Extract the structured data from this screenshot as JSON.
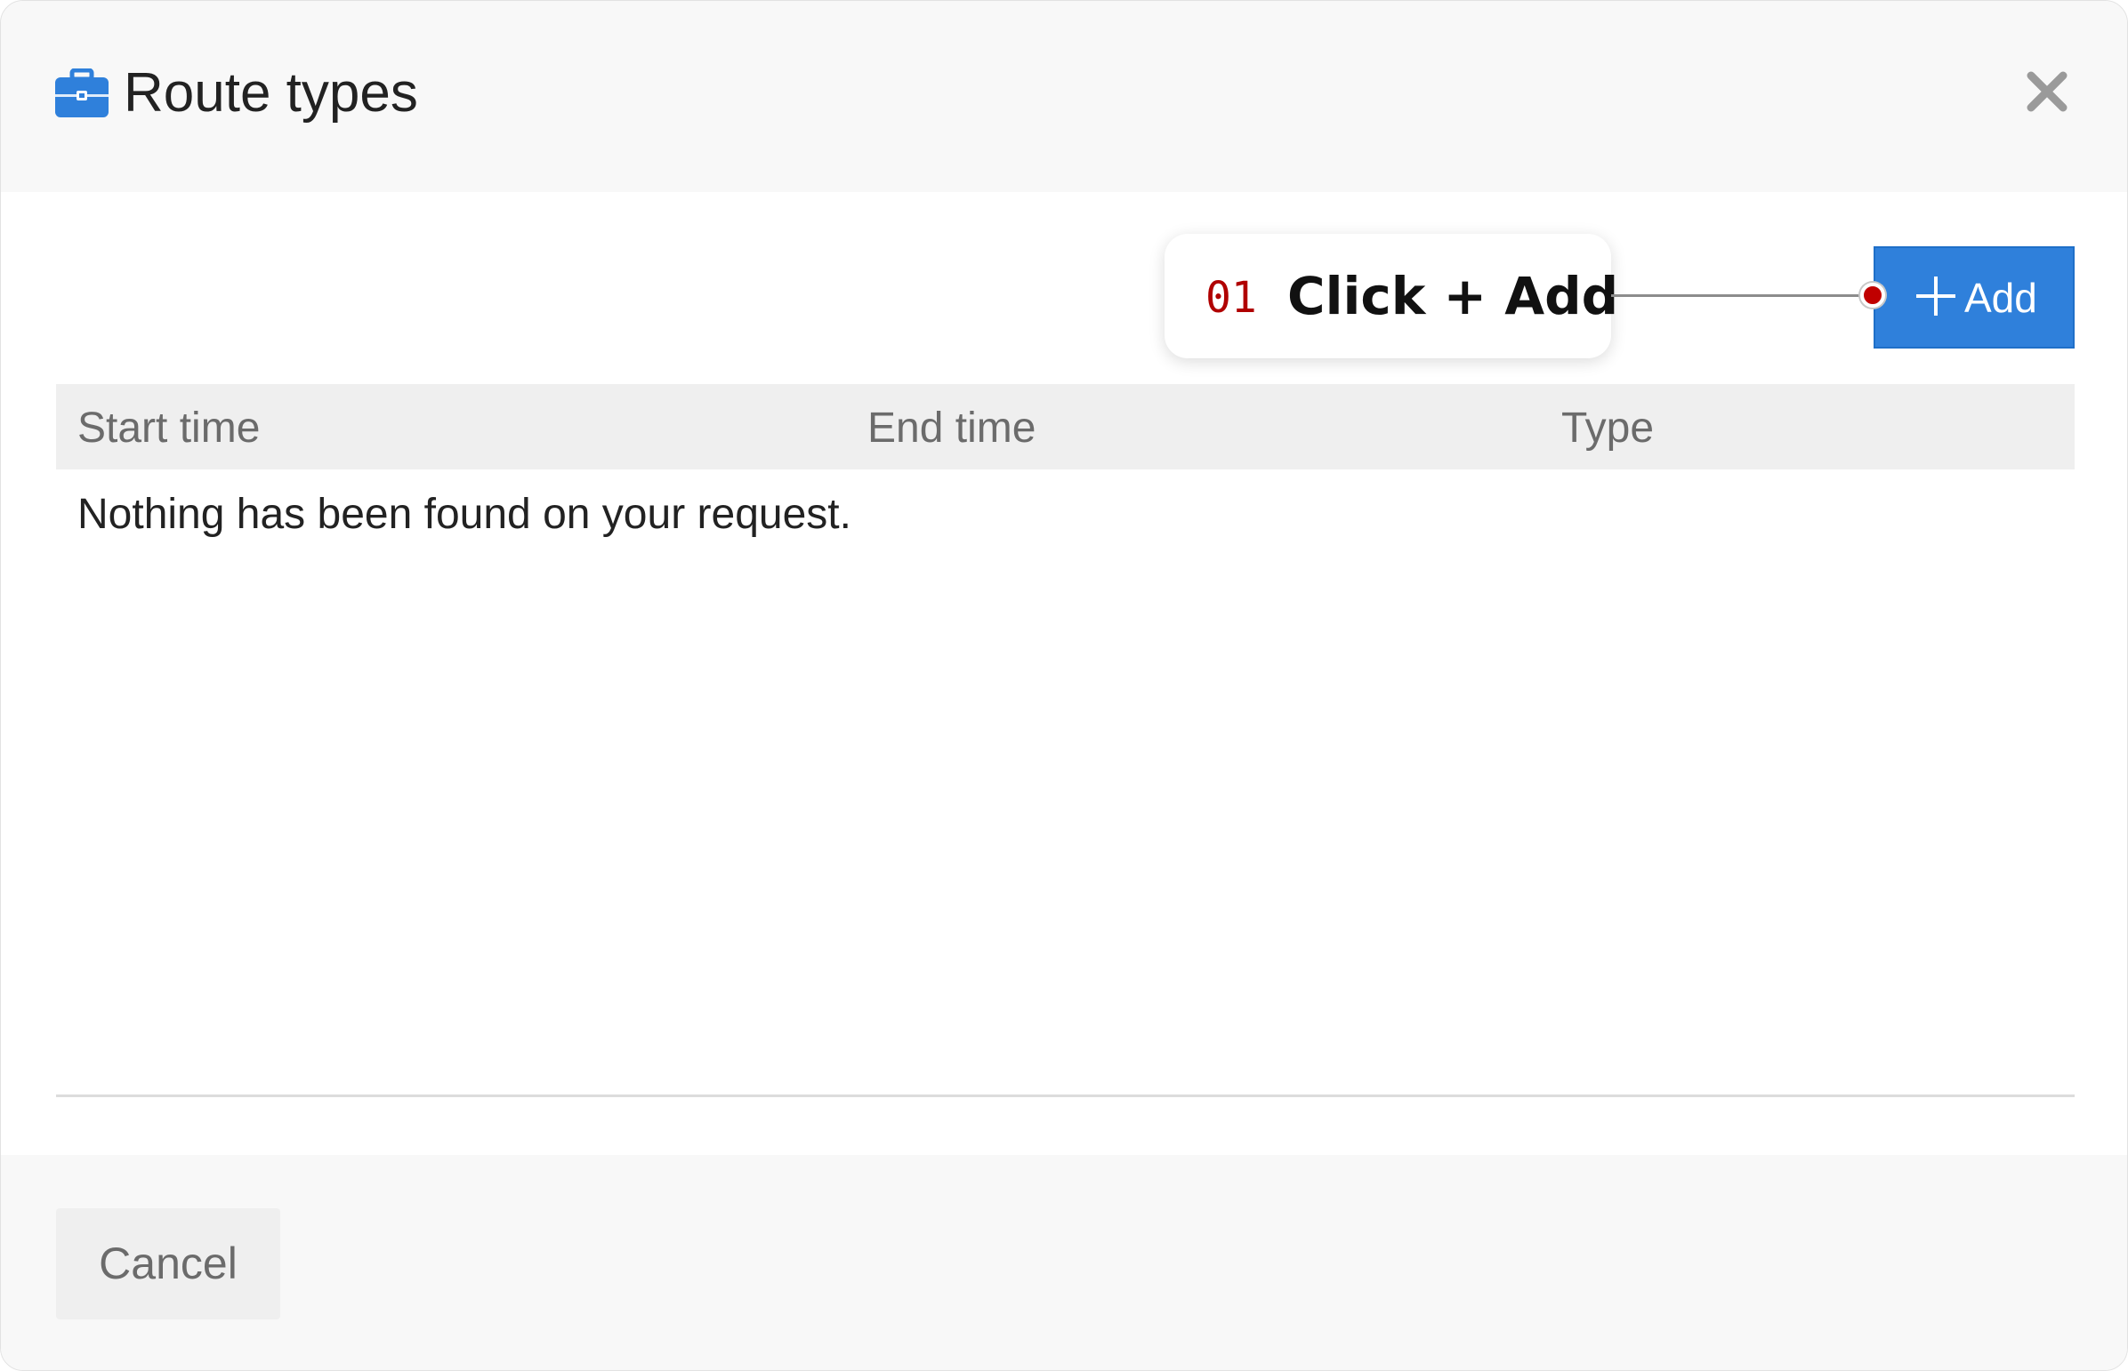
{
  "dialog": {
    "title": "Route types",
    "title_icon": "briefcase-icon",
    "close_icon": "close-icon"
  },
  "toolbar": {
    "add_label": "Add",
    "add_icon": "plus-icon"
  },
  "callout": {
    "step": "01",
    "text": "Click + Add"
  },
  "table": {
    "columns": [
      "Start time",
      "End time",
      "Type"
    ],
    "empty_message": "Nothing has been found on your request."
  },
  "footer": {
    "cancel_label": "Cancel"
  },
  "colors": {
    "accent": "#2f80db",
    "callout_step": "#b00000",
    "dialog_background": "#f8f8f8"
  }
}
